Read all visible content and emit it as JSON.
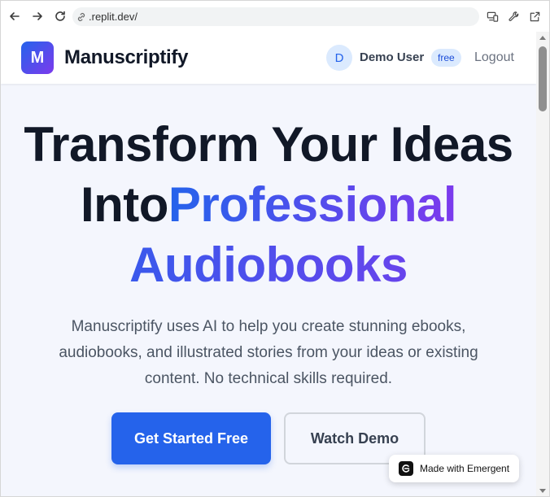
{
  "browser": {
    "url": ".replit.dev/"
  },
  "header": {
    "logo_letter": "M",
    "brand": "Manuscriptify",
    "user_initial": "D",
    "user_name": "Demo User",
    "plan": "free",
    "logout": "Logout"
  },
  "hero": {
    "title_line1": "Transform Your Ideas",
    "title_line2_plain": "Into",
    "title_line2_gradient": "Professional",
    "title_line3_gradient": "Audiobooks",
    "subtitle": "Manuscriptify uses AI to help you create stunning ebooks, audiobooks, and illustrated stories from your ideas or existing content. No technical skills required.",
    "primary_cta": "Get Started Free",
    "secondary_cta": "Watch Demo"
  },
  "badge": {
    "text": "Made with Emergent"
  },
  "colors": {
    "primary": "#2563eb",
    "accent": "#7c3aed",
    "page_bg": "#f4f6fd"
  },
  "icons": [
    "back-arrow-icon",
    "forward-arrow-icon",
    "reload-icon",
    "link-icon",
    "devices-icon",
    "wrench-icon",
    "open-external-icon",
    "emergent-logo-icon"
  ]
}
